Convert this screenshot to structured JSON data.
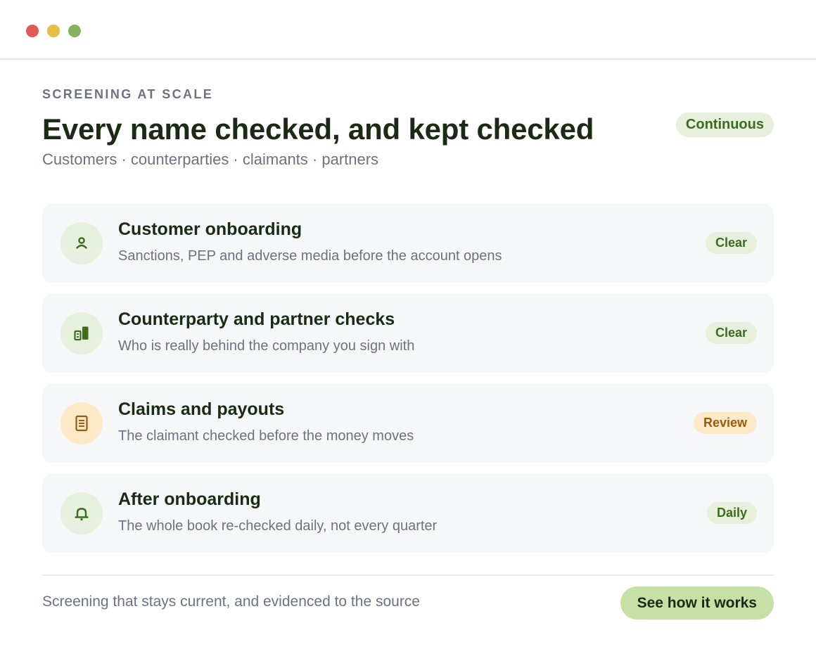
{
  "window": {
    "controls": [
      "close",
      "minimize",
      "maximize"
    ]
  },
  "header": {
    "eyebrow": "SCREENING AT SCALE",
    "title": "Every name checked, and kept checked",
    "subtitle": "Customers · counterparties · claimants · partners",
    "badge": "Continuous"
  },
  "items": [
    {
      "title": "Customer onboarding",
      "description": "Sanctions, PEP and adverse media before the account opens",
      "status": "Clear",
      "icon": "person-icon"
    },
    {
      "title": "Counterparty and partner checks",
      "description": "Who is really behind the company you sign with",
      "status": "Clear",
      "icon": "building-icon"
    },
    {
      "title": "Claims and payouts",
      "description": "The claimant checked before the money moves",
      "status": "Review",
      "icon": "document-icon"
    },
    {
      "title": "After onboarding",
      "description": "The whole book re-checked daily, not every quarter",
      "status": "Daily",
      "icon": "bell-icon"
    }
  ],
  "footer": {
    "text": "Screening that stays current, and evidenced to the source",
    "cta_label": "See how it works"
  },
  "colors": {
    "brand_green": "#3d6b1f",
    "green_tint": "#e6f0dc",
    "amber": "#9a5b10",
    "amber_tint": "#fde9c8",
    "cta_fill": "#c6e0a5",
    "heading": "#1b2a14",
    "muted": "#6b7280"
  }
}
